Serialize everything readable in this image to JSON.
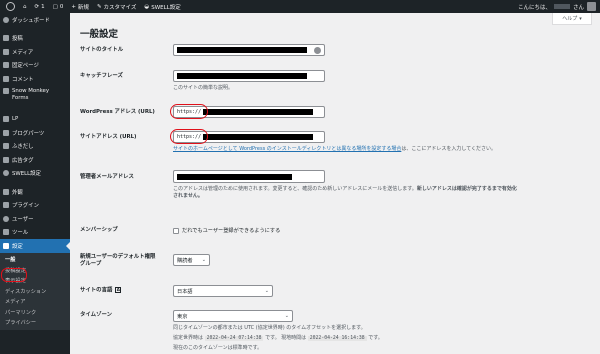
{
  "adminbar": {
    "site_name": "ダッシュボード",
    "updates_count": "1",
    "comments_count": "0",
    "new_label": "新規",
    "customize_label": "カスタマイズ",
    "swell_label": "SWELL設定",
    "greeting_prefix": "こんにちは、",
    "greeting_suffix": "さん"
  },
  "sidebar": {
    "items": [
      {
        "label": "ダッシュボード"
      },
      {
        "label": "投稿"
      },
      {
        "label": "メディア"
      },
      {
        "label": "固定ページ"
      },
      {
        "label": "コメント"
      },
      {
        "label": "Snow Monkey Forms"
      },
      {
        "label": "LP"
      },
      {
        "label": "ブログパーツ"
      },
      {
        "label": "ふきだし"
      },
      {
        "label": "広告タグ"
      },
      {
        "label": "SWELL設定"
      },
      {
        "label": "外観"
      },
      {
        "label": "プラグイン"
      },
      {
        "label": "ユーザー"
      },
      {
        "label": "ツール"
      },
      {
        "label": "設定"
      }
    ],
    "submenu": [
      "一般",
      "投稿設定",
      "表示設定",
      "ディスカッション",
      "メディア",
      "パーマリンク",
      "プライバシー"
    ]
  },
  "help_label": "ヘルプ",
  "page_title": "一般設定",
  "form": {
    "site_title_label": "サイトのタイトル",
    "tagline_label": "キャッチフレーズ",
    "tagline_desc": "このサイトの簡単な説明。",
    "wp_url_label": "WordPress アドレス (URL)",
    "wp_url_prefix": "https://",
    "site_url_label": "サイトアドレス (URL)",
    "site_url_prefix": "https://",
    "site_url_desc_link": "サイトのホームページとして WordPress のインストールディレクトリとは異なる場所を設定する場合",
    "site_url_desc_tail": "は、ここにアドレスを入力してください。",
    "admin_email_label": "管理者メールアドレス",
    "admin_email_desc_1": "このアドレスは管理のために使用されます。変更すると、確認のため新しいアドレスにメールを送信します。",
    "admin_email_desc_bold": "新しいアドレスは確認が完了するまで有効化",
    "admin_email_desc_2": "されません。",
    "membership_label": "メンバーシップ",
    "membership_checkbox": "だれでもユーザー登録ができるようにする",
    "default_role_label_1": "新規ユーザーのデフォルト権限",
    "default_role_label_2": "グループ",
    "default_role_value": "購読者",
    "site_language_label": "サイトの言語",
    "site_language_value": "日本語",
    "timezone_label": "タイムゾーン",
    "timezone_value": "東京",
    "timezone_desc": "同じタイムゾーンの都市または UTC (協定世界時) のタイムオフセットを選択します。",
    "utc_time_label": "協定世界時は",
    "utc_time_value": "2022-04-24 07:14:38",
    "local_time_mid": "です。 現地時間は",
    "local_time_value": "2022-04-24 16:14:38",
    "local_time_tail": "です。",
    "dst_desc": "現在のこのタイムゾーンは標準時です。"
  }
}
